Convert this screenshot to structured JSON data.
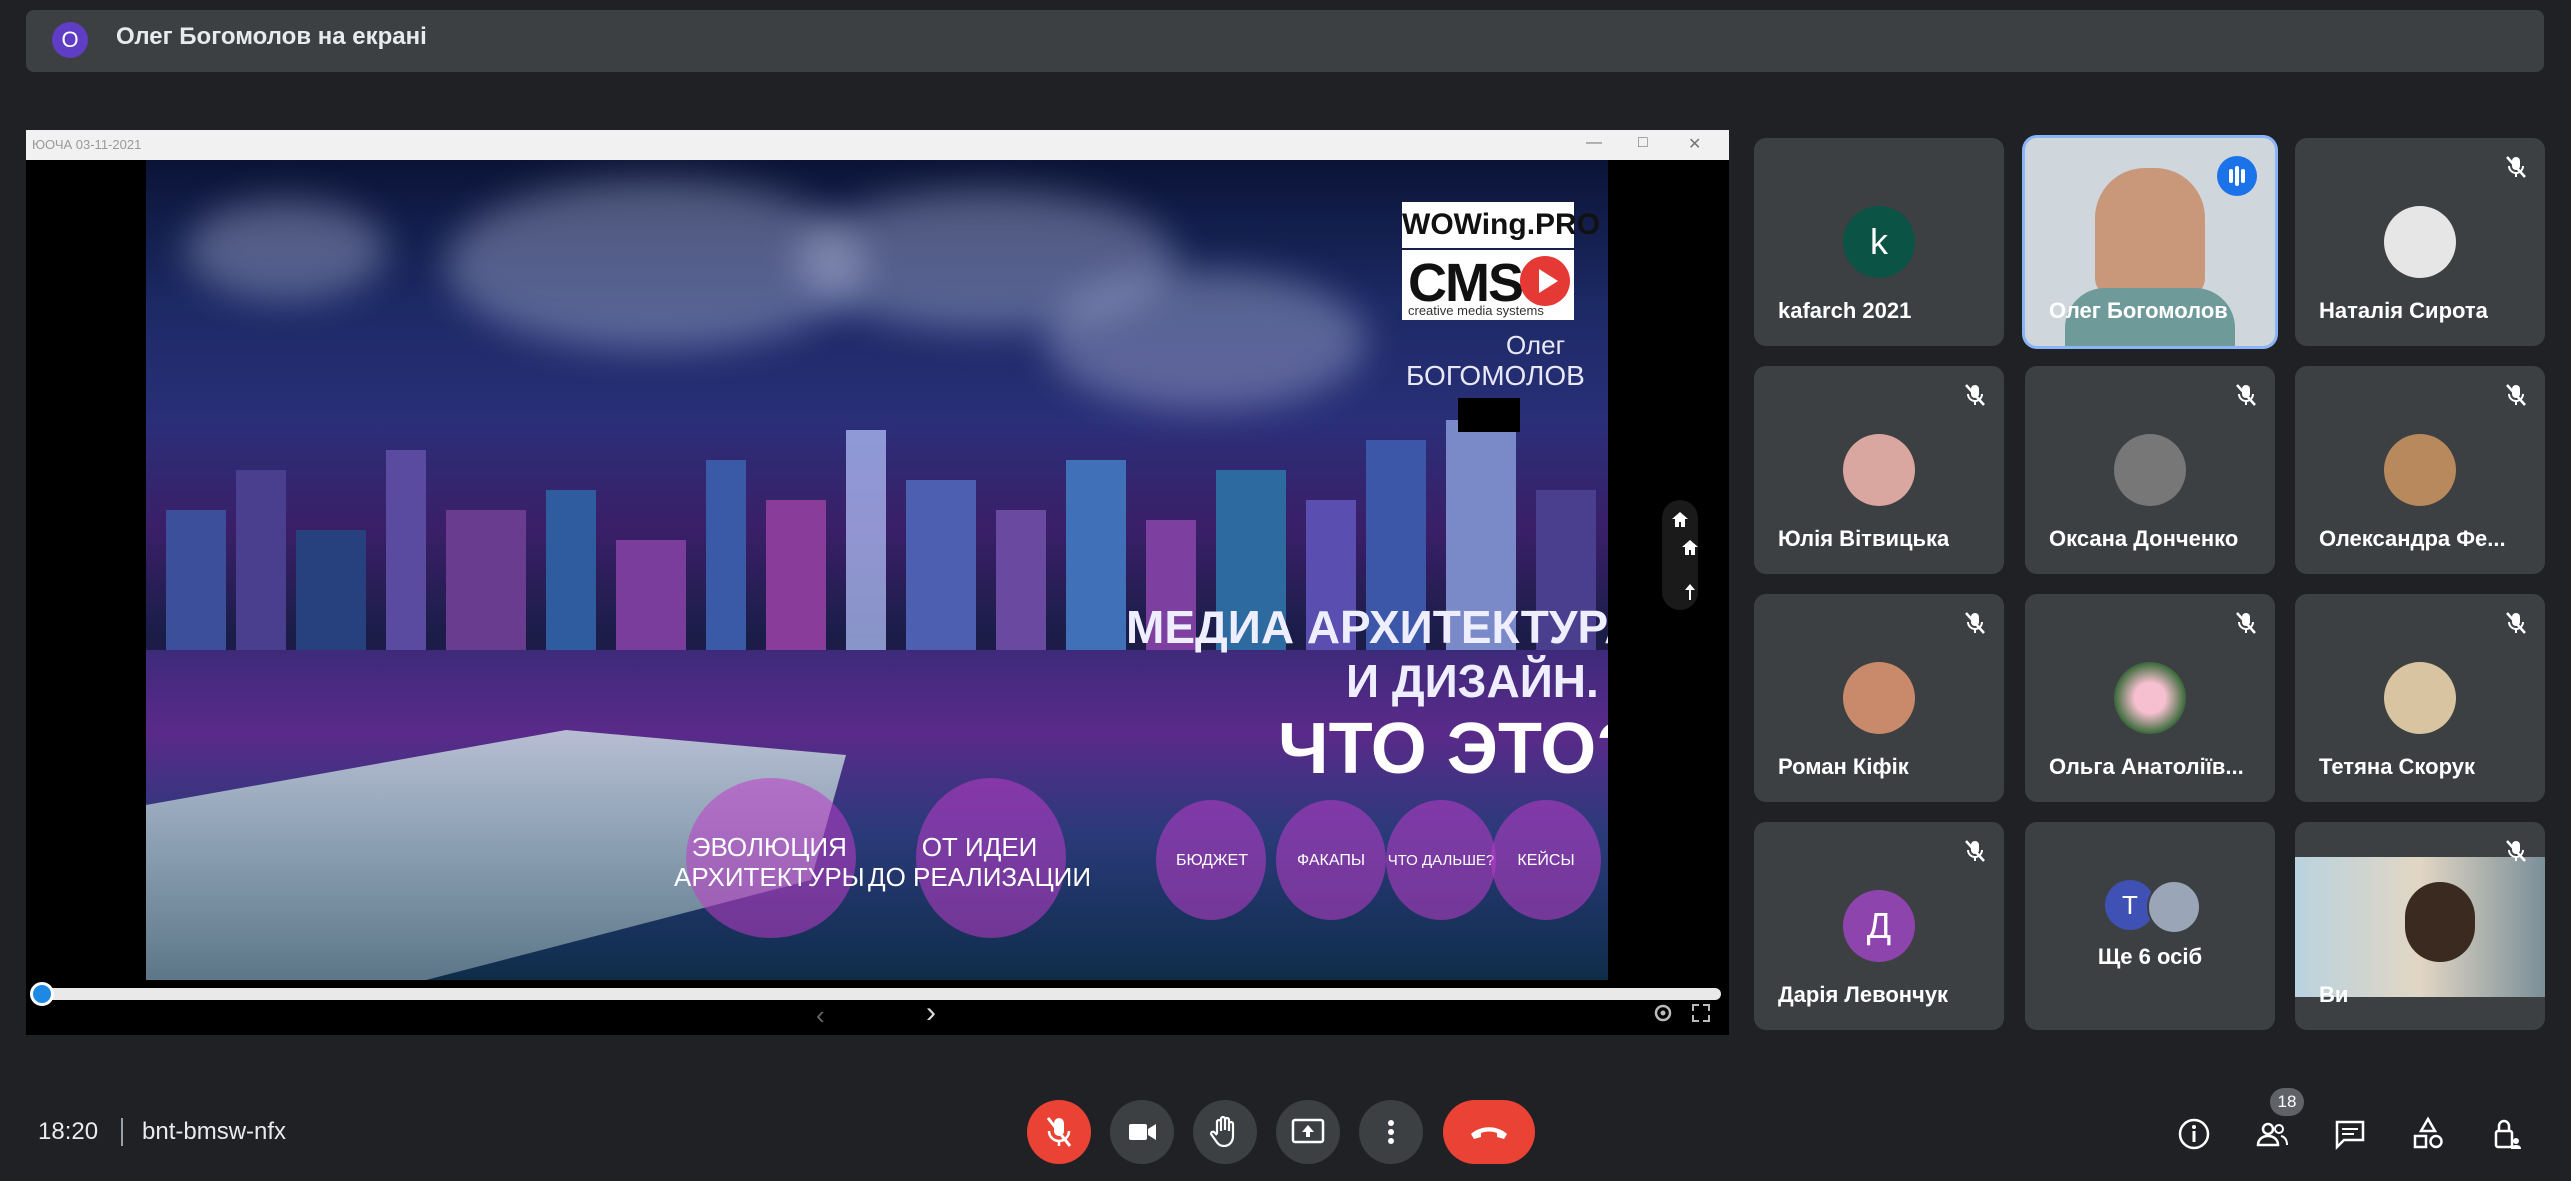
{
  "banner": {
    "avatar_letter": "О",
    "text": "Олег Богомолов на екрані"
  },
  "share": {
    "window_title": "ЮОЧА 03-11-2021",
    "slide": {
      "brand_top": "WOWing.PRO",
      "brand_main": "CMS",
      "brand_sub": "creative media systems",
      "person_first": "Олег",
      "person_last": "БОГОМОЛОВ",
      "headline_line1": "МЕДИА АРХИТЕКТУРА",
      "headline_line2": "И ДИЗАЙН.",
      "headline_question": "ЧТО ЭТО?",
      "bubbles": [
        {
          "line1": "ЭВОЛЮЦИЯ",
          "line2": "АРХИТЕКТУРЫ"
        },
        {
          "line1": "ОТ ИДЕИ",
          "line2": "ДО РЕАЛИЗАЦИИ"
        },
        {
          "line1": "БЮДЖЕТ",
          "line2": ""
        },
        {
          "line1": "ФАКАПЫ",
          "line2": ""
        },
        {
          "line1": "ЧТО ДАЛЬШЕ?",
          "line2": ""
        },
        {
          "line1": "КЕЙСЫ",
          "line2": ""
        }
      ]
    }
  },
  "participants": [
    {
      "name": "kafarch 2021",
      "avatar": "k",
      "avatar_color": "#0b5345",
      "muted": false
    },
    {
      "name": "Олег Богомолов",
      "avatar": "",
      "muted": false,
      "speaking": true
    },
    {
      "name": "Наталія Сирота",
      "avatar": "",
      "muted": true
    },
    {
      "name": "Юлія Вітвицька",
      "avatar": "",
      "muted": true
    },
    {
      "name": "Оксана Донченко",
      "avatar": "",
      "muted": true
    },
    {
      "name": "Олександра Фе...",
      "avatar": "",
      "muted": true
    },
    {
      "name": "Роман Кіфік",
      "avatar": "",
      "muted": true
    },
    {
      "name": "Ольга Анатоліїв...",
      "avatar": "",
      "muted": true
    },
    {
      "name": "Тетяна Скорук",
      "avatar": "",
      "muted": true
    },
    {
      "name": "Дарія Левончук",
      "avatar": "Д",
      "avatar_color": "#8e44ad",
      "muted": true
    },
    {
      "name": "Ще 6 осіб",
      "avatar": "Т",
      "avatar_color": "#3f51b5",
      "muted": false
    },
    {
      "name": "Ви",
      "avatar": "",
      "muted": true
    }
  ],
  "bottom_bar": {
    "time": "18:20",
    "meeting_code": "bnt-bmsw-nfx",
    "participants_count": "18"
  },
  "colors": {
    "background": "#202124",
    "tile": "#3c4043",
    "accent": "#1a73e8",
    "danger": "#ea4335"
  }
}
